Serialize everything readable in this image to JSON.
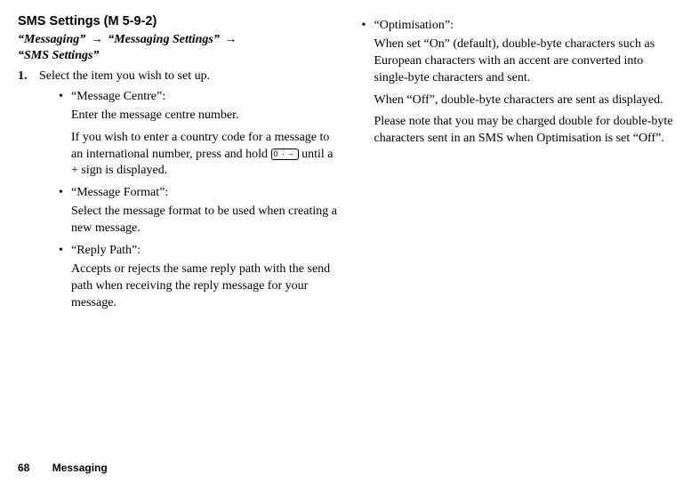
{
  "heading": "SMS Settings (M 5-9-2)",
  "breadcrumb": {
    "p1": "“Messaging”",
    "p2": "“Messaging Settings”",
    "p3": "“SMS Settings”",
    "arrow": "→"
  },
  "step1": {
    "num": "1.",
    "text": "Select the item you wish to set up."
  },
  "left_bullets": [
    {
      "title": "“Message Centre”:",
      "line1": "Enter the message centre number.",
      "para2a": "If you wish to enter a country code for a message to an international number, press and hold ",
      "key": "0",
      "para2b": " until a + sign is displayed."
    },
    {
      "title": "“Message Format”:",
      "line1": "Select the message format to be used when creating a new message."
    },
    {
      "title": "“Reply Path”:",
      "line1": "Accepts or rejects the same reply path with the send path when receiving the reply message for your message."
    }
  ],
  "right_bullets": [
    {
      "title": "“Optimisation”:",
      "line1": "When set “On” (default), double-byte characters such as European characters with an accent are converted into single-byte characters and sent.",
      "line2": "When “Off”, double-byte characters are sent as displayed.",
      "line3": "Please note that you may be charged double for double-byte characters sent in an SMS when Optimisation is set “Off”."
    }
  ],
  "footer": {
    "page": "68",
    "section": "Messaging"
  }
}
